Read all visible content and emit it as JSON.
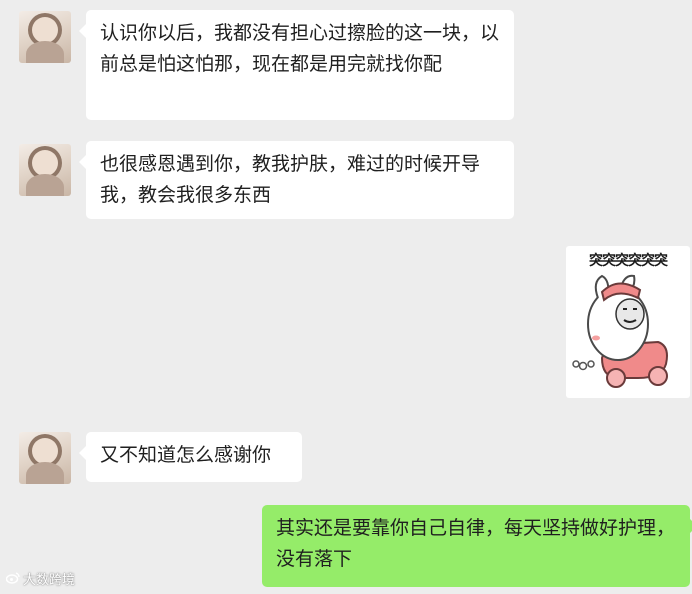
{
  "messages": [
    {
      "sender": "contact",
      "text": "认识你以后，我都没有担心过擦脸的这一块，以前总是怕这怕那，现在都是用完就找你配"
    },
    {
      "sender": "contact",
      "text": "也很感恩遇到你，教我护肤，难过的时候开导我，教会我很多东西"
    },
    {
      "sender": "me",
      "type": "sticker",
      "caption": "突突突突突突",
      "sticker_icon": "rabbit-scooter-meme-sticker"
    },
    {
      "sender": "contact",
      "text": "又不知道怎么感谢你"
    },
    {
      "sender": "me",
      "text": "其实还是要靠你自己自律，每天坚持做好护理，没有落下"
    }
  ],
  "watermark": {
    "icon": "weibo-logo-icon",
    "text": "大数跨境"
  },
  "colors": {
    "background": "#ededed",
    "incoming_bubble": "#ffffff",
    "outgoing_bubble": "#95ec69"
  }
}
